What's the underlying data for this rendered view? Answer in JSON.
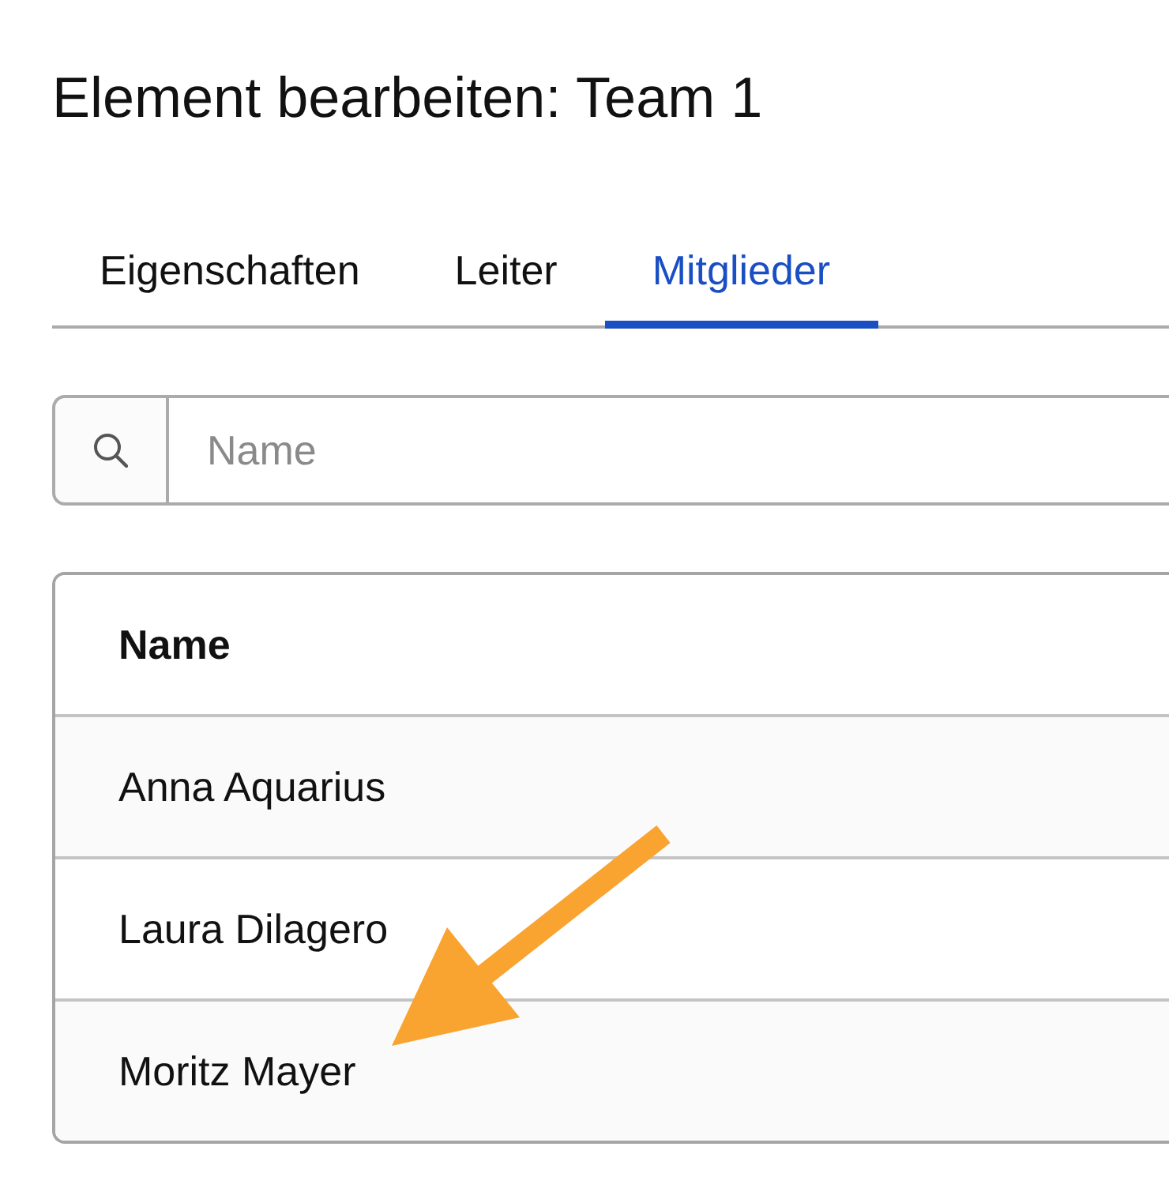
{
  "page": {
    "title": "Element bearbeiten: Team 1"
  },
  "tabs": [
    {
      "label": "Eigenschaften",
      "selected": false
    },
    {
      "label": "Leiter",
      "selected": false
    },
    {
      "label": "Mitglieder",
      "selected": true
    }
  ],
  "search": {
    "placeholder": "Name"
  },
  "table": {
    "columns": [
      "Name"
    ],
    "rows": [
      [
        "Anna Aquarius"
      ],
      [
        "Laura Dilagero"
      ],
      [
        "Moritz Mayer"
      ]
    ]
  }
}
